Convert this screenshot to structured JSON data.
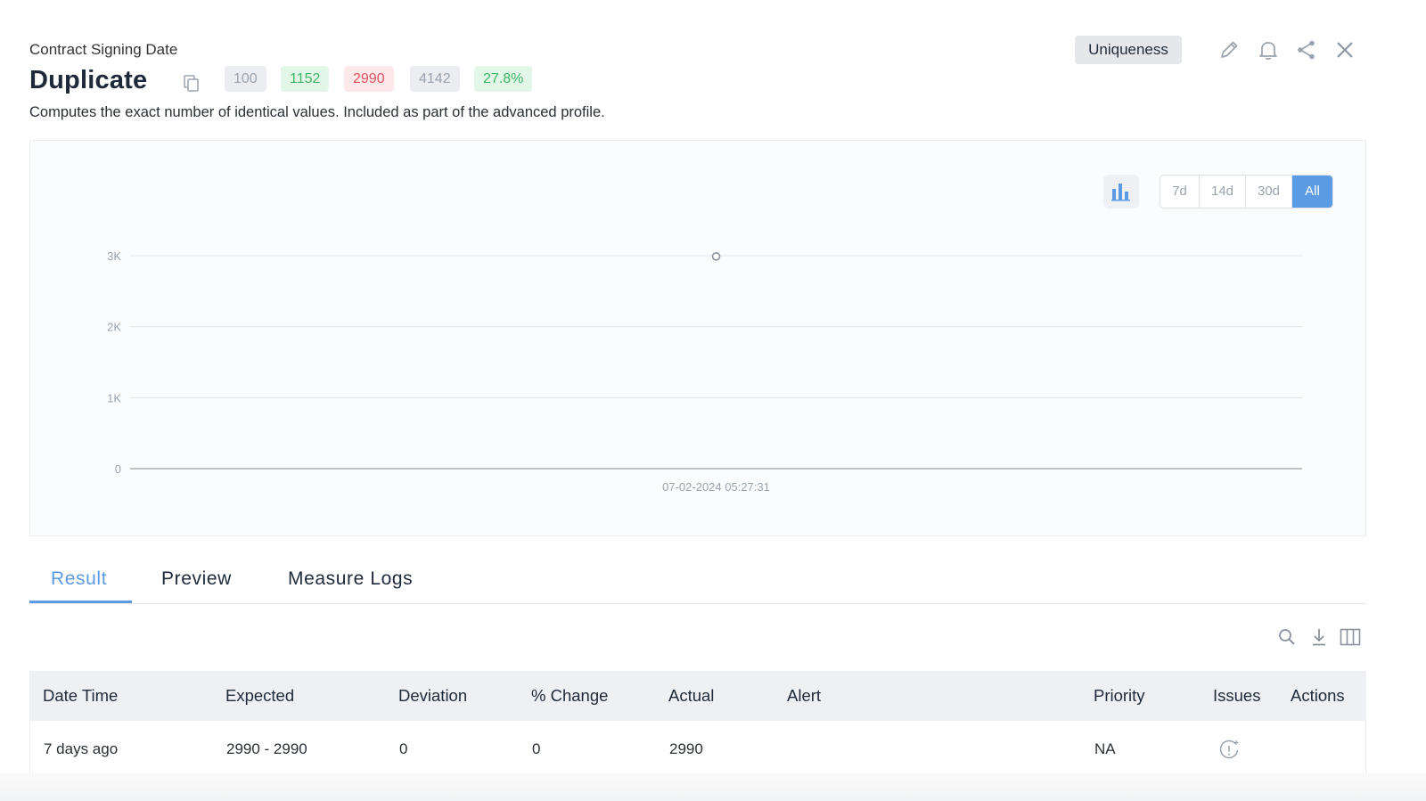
{
  "header": {
    "breadcrumb": "Contract Signing Date",
    "title": "Duplicate",
    "description": "Computes the exact number of identical values. Included as part of the advanced profile.",
    "category_badge": "Uniqueness",
    "stats": [
      {
        "value": "100",
        "bg": "#ebedf0",
        "fg": "#9aa3ae"
      },
      {
        "value": "1152",
        "bg": "#e3f7e9",
        "fg": "#3fb766"
      },
      {
        "value": "2990",
        "bg": "#fde8ea",
        "fg": "#e2545f"
      },
      {
        "value": "4142",
        "bg": "#ebedf0",
        "fg": "#9aa3ae"
      },
      {
        "value": "27.8%",
        "bg": "#e3f7e9",
        "fg": "#3fb766"
      }
    ],
    "icons": {
      "copy": "copy-icon",
      "edit": "pencil-icon",
      "alert": "bell-icon",
      "share": "share-icon",
      "close": "close-icon"
    }
  },
  "chart_controls": {
    "chart_type_icon": "bar-chart-icon",
    "ranges": [
      "7d",
      "14d",
      "30d",
      "All"
    ],
    "active_range": "All"
  },
  "chart_data": {
    "type": "line",
    "x": [
      "07-02-2024 05:27:31"
    ],
    "series": [
      {
        "values": [
          2990
        ]
      }
    ],
    "ylim": [
      0,
      3000
    ],
    "yticks": [
      0,
      1000,
      2000,
      3000
    ],
    "ytick_labels": [
      "0",
      "1K",
      "2K",
      "3K"
    ],
    "grid": true,
    "title": "",
    "xlabel": "",
    "ylabel": ""
  },
  "tabs": [
    {
      "label": "Result",
      "active": true
    },
    {
      "label": "Preview",
      "active": false
    },
    {
      "label": "Measure Logs",
      "active": false
    }
  ],
  "table_tools": {
    "search": "search-icon",
    "download": "download-icon",
    "columns": "columns-icon"
  },
  "table": {
    "columns": [
      "Date Time",
      "Expected",
      "Deviation",
      "% Change",
      "Actual",
      "Alert",
      "Priority",
      "Issues",
      "Actions"
    ],
    "rows": [
      {
        "date_time": "7 days ago",
        "expected": "2990 - 2990",
        "deviation": "0",
        "change": "0",
        "actual": "2990",
        "alert": "",
        "priority": "NA",
        "issues_icon": "add-issue-icon",
        "actions": ""
      }
    ]
  },
  "colors": {
    "accent": "#5a9be3",
    "positive": "#3fb766",
    "negative": "#e2545f"
  }
}
